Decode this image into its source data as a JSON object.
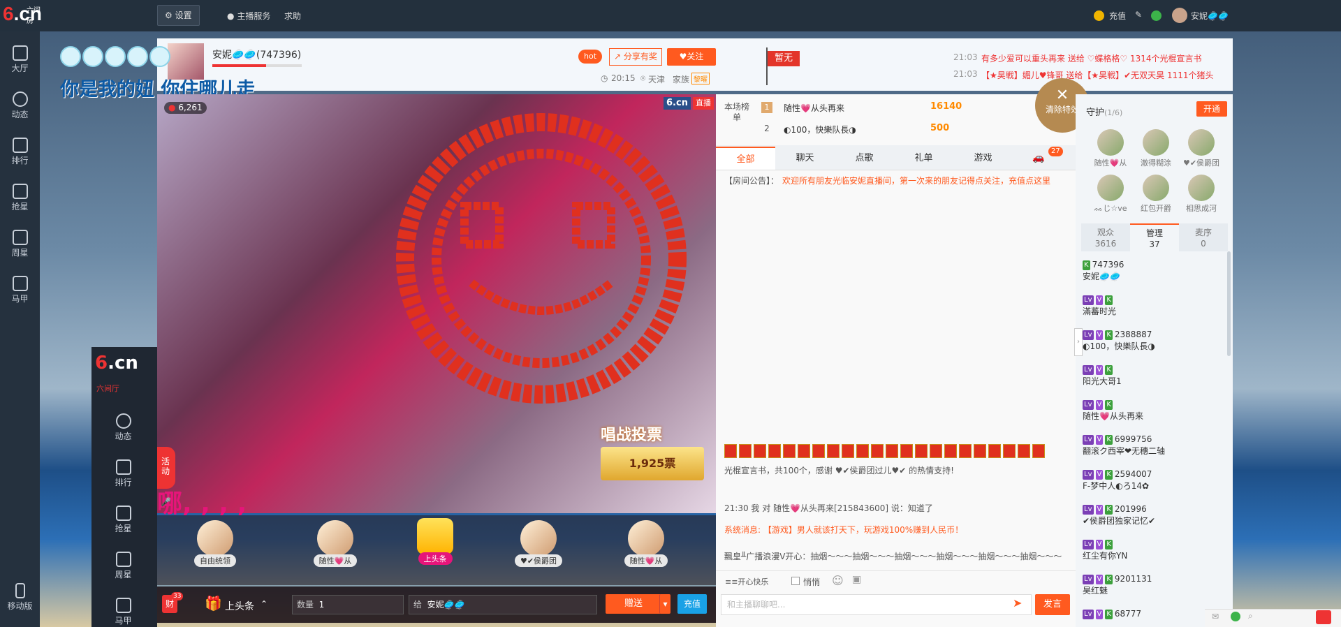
{
  "top": {
    "logo": "6.cn",
    "logo_small": "六间房",
    "settings": "设置",
    "host_service": "主播服务",
    "help": "求助",
    "recharge": "充值",
    "username": "安妮🥏🥏"
  },
  "sidebar": [
    {
      "label": "大厅",
      "icon": "tv-icon"
    },
    {
      "label": "动态",
      "icon": "compass-icon"
    },
    {
      "label": "排行",
      "icon": "crown-icon"
    },
    {
      "label": "抢星",
      "icon": "star-icon"
    },
    {
      "label": "周星",
      "icon": "cup-icon"
    },
    {
      "label": "马甲",
      "icon": "shirt-icon"
    }
  ],
  "sidebar_bottom": "移动版",
  "overlay_text": "你是我的妞 你住哪儿走",
  "host": {
    "name": "安妮🥏🥏(747396)",
    "hot": "hot",
    "share": "分享有奖",
    "follow": "关注",
    "time": "20:15",
    "city": "天津",
    "family": "家族",
    "family_badge": "黎曜",
    "flag": "暂无"
  },
  "announcements": [
    {
      "time": "21:03",
      "text": "有多少爱可以重头再来 送给 ♡蝶格格♡ 1314个光棍宣言书"
    },
    {
      "time": "21:03",
      "text": "【★昊戦】媚儿♥锋哥 送给【★昊戦】✔无双天昊 1111个猪头"
    }
  ],
  "clear_effects": "清除特效",
  "video": {
    "wealth": "6,261",
    "brand": "6.cn",
    "live": "直播",
    "vote_title": "唱战投票",
    "votes": "1,925票",
    "activity": "活动",
    "lyric": "哪, , , ,",
    "bottom_label": "六间厅"
  },
  "ranking": {
    "label": "本场榜单",
    "rows": [
      {
        "rank": "1",
        "name": "随性💗从头再来",
        "score": "16140"
      },
      {
        "rank": "2",
        "name": "◐100，快樂队長◑",
        "score": "500"
      }
    ]
  },
  "chat_tabs": [
    "全部",
    "聊天",
    "点歌",
    "礼单",
    "游戏"
  ],
  "car_count": "27",
  "room_notice_label": "【房间公告】：",
  "room_notice": "欢迎所有朋友光临安妮直播间，第一次来的朋友记得点关注，充值点这里",
  "chat_messages": [
    {
      "text": "光棍宣言书，共100个，感谢 ♥✔侯爵团过儿♥✔ 的热情支持!"
    },
    {
      "text": "21:30  我 对 随性💗从头再来[215843600] 说：知道了"
    },
    {
      "text": "系统消息: 【游戏】男人就该打天下，玩游戏100%赚到人民币！"
    },
    {
      "text": "飄皇╨广播浪漫V开心：抽烟～～～抽烟～～～抽烟～～～抽烟～～～抽烟～～～抽烟～～～"
    }
  ],
  "chat_input": {
    "whisper_label": "悄悄",
    "mode": "≡≡开心快乐",
    "placeholder": "和主播聊聊吧...",
    "send": "发言"
  },
  "guard": {
    "title": "守护",
    "count": "(1/6)",
    "open": "开通",
    "members": [
      "随性💗从",
      "澈得糊涂",
      "♥✔侯爵团",
      "ᨐじ☆ve",
      "红包开爵",
      "相思成河"
    ]
  },
  "user_tabs": [
    {
      "label": "观众",
      "count": "3616"
    },
    {
      "label": "管理",
      "count": "37"
    },
    {
      "label": "麦序",
      "count": "0"
    }
  ],
  "users": [
    {
      "id": "747396",
      "name": "安妮🥏🥏"
    },
    {
      "id": "",
      "name": "滿蕃时光"
    },
    {
      "id": "2388887",
      "name": "◐100，快樂队長◑"
    },
    {
      "id": "",
      "name": "阳光大哥1"
    },
    {
      "id": "",
      "name": "随性💗从头再来"
    },
    {
      "id": "6999756",
      "name": "翻滚ク西宰❤无穗二轴"
    },
    {
      "id": "2594007",
      "name": "F-梦中人◐ろ14✿"
    },
    {
      "id": "201996",
      "name": "✔侯爵团独家记忆✔"
    },
    {
      "id": "",
      "name": "红尘有你YN"
    },
    {
      "id": "9201131",
      "name": "昊红魅"
    },
    {
      "id": "68777",
      "name": ""
    }
  ],
  "gifts": [
    {
      "label": "自由统领"
    },
    {
      "label": "随性💗从"
    },
    {
      "label": "上头条"
    },
    {
      "label": "♥✔侯爵团"
    },
    {
      "label": "随性💗从"
    }
  ],
  "bottom": {
    "wealth_count": "33",
    "wealth_label": "财",
    "gift_name": "上头条",
    "qty_label": "数量",
    "qty": "1",
    "to_label": "给",
    "to_name": "安妮🥏🥏",
    "give": "赠送",
    "recharge": "充值"
  },
  "colors": {
    "accent": "#ff5a1f",
    "brand_red": "#e33",
    "topbar": "#23303d",
    "blue": "#19a1e6"
  }
}
